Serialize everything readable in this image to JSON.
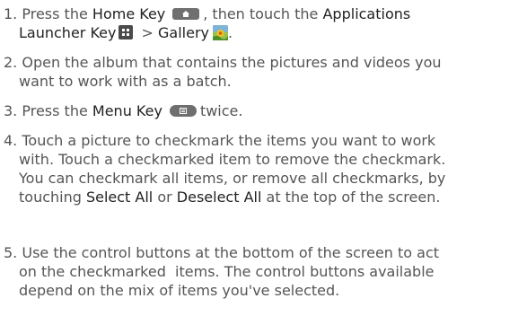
{
  "steps": [
    {
      "number": "1.",
      "line1_a": "Press the ",
      "line1_home": "Home Key",
      "line1_b": ", then touch the ",
      "line1_apps": "Applications",
      "line2_apps": "Launcher Key",
      "line2_sep": " > ",
      "line2_gallery": "Gallery",
      "icons": [
        "home-key-icon",
        "applications-launcher-icon",
        "gallery-icon"
      ]
    },
    {
      "number": "2.",
      "line1": "Open the album that contains the pictures and videos you",
      "line2": "want to work with as a batch."
    },
    {
      "number": "3.",
      "line1_a": "Press the ",
      "line1_menu": "Menu Key",
      "line1_b": "twice.",
      "icons": [
        "menu-key-icon"
      ]
    },
    {
      "number": "4.",
      "line1": "Touch a picture to checkmark the items you want to work",
      "line2": "with. Touch a checkmarked item to remove the checkmark.",
      "line3": "You can checkmark all items, or remove all checkmarks, by",
      "line4_a": "touching ",
      "line4_select": "Select All",
      "line4_or": " or ",
      "line4_deselect": "Deselect All",
      "line4_b": " at the top of the screen."
    },
    {
      "number": "5.",
      "line1": "Use the control buttons at the bottom of the screen to act",
      "line2": "on the checkmarked  items. The control buttons available",
      "line3": "depend on the mix of items you've selected."
    }
  ]
}
